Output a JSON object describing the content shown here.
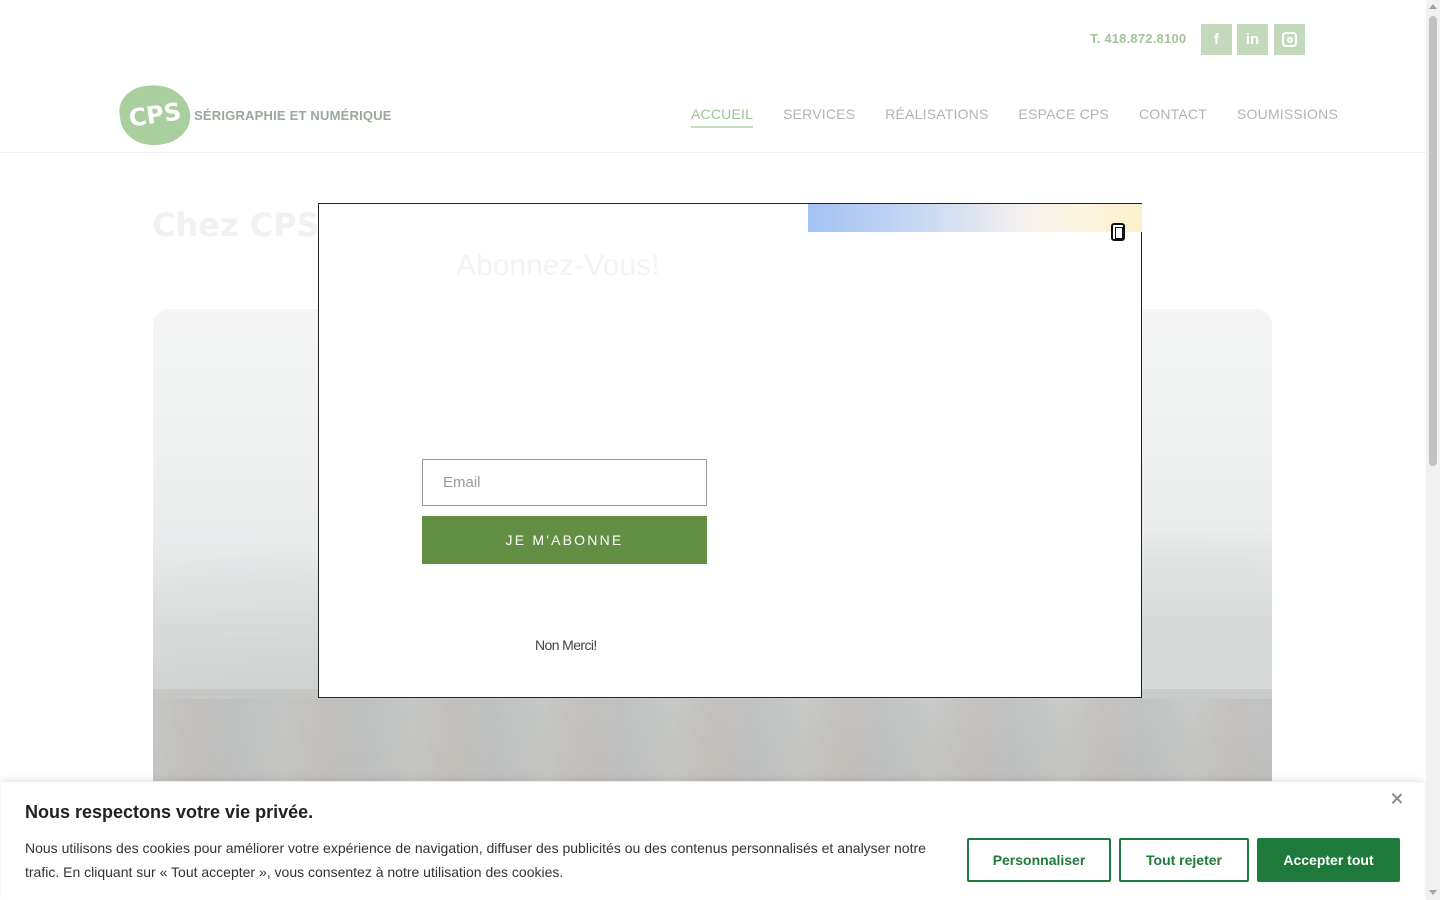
{
  "header": {
    "phone": "T. 418.872.8100",
    "social": {
      "facebook": "f",
      "linkedin": "in"
    },
    "logo": {
      "mark": "CPS",
      "tagline": "SÉRIGRAPHIE ET NUMÉRIQUE"
    },
    "nav": [
      {
        "label": "ACCUEIL",
        "active": true
      },
      {
        "label": "SERVICES"
      },
      {
        "label": "RÉALISATIONS"
      },
      {
        "label": "ESPACE CPS"
      },
      {
        "label": "CONTACT"
      },
      {
        "label": "SOUMISSIONS"
      }
    ]
  },
  "hero": {
    "title": "Chez CPS,"
  },
  "modal": {
    "heading": "Abonnez-Vous!",
    "email_placeholder": "Email",
    "subscribe_label": "JE M'ABONNE",
    "no_thanks_label": "Non Merci!",
    "close_icon": "close-icon"
  },
  "cookie": {
    "title": "Nous respectons votre vie privée.",
    "text": "Nous utilisons des cookies pour améliorer votre expérience de navigation, diffuser des publicités ou des contenus personnalisés et analyser notre trafic. En cliquant sur « Tout accepter », vous consentez à notre utilisation des cookies.",
    "personalize_label": "Personnaliser",
    "reject_label": "Tout rejeter",
    "accept_label": "Accepter tout"
  },
  "colors": {
    "brand_green": "#638f44",
    "cookie_green": "#1e7a3a",
    "nav_active": "#9fc294"
  }
}
